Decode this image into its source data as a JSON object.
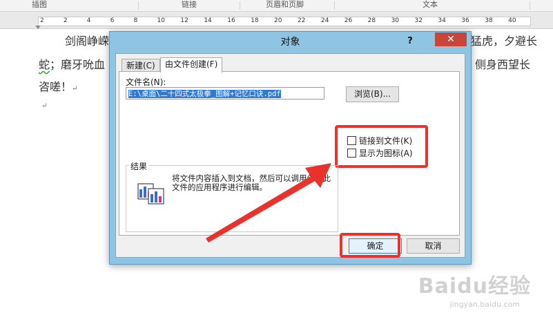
{
  "ribbon": {
    "groups": [
      "插图",
      "链接",
      "页眉和页脚",
      "文本"
    ]
  },
  "ruler": {
    "ticks": [
      "2",
      "2",
      "4",
      "6",
      "8",
      "10",
      "12",
      "14",
      "16",
      "18",
      "20",
      "22",
      "24",
      "26",
      "28",
      "30",
      "32",
      "34",
      "36",
      "38",
      "40"
    ]
  },
  "document": {
    "line1_start": "剑阁峥嵘",
    "line1_end": "猛虎，夕避长",
    "line2_start_wavy": "蛇",
    "line2_start_rest": "；磨牙吮血",
    "line2_end": "，侧身西望长",
    "line3": "咨嗟！",
    "para_mark": "↵"
  },
  "dialog": {
    "title": "对象",
    "help": "?",
    "close": "✕",
    "tabs": [
      {
        "label": "新建(C)",
        "active": false
      },
      {
        "label": "由文件创建(F)",
        "active": true
      }
    ],
    "file_name_label": "文件名(N):",
    "file_name_value": "E:\\桌面\\二十四式太极拳_图解+记忆口诀.pdf",
    "browse_label": "浏览(B)...",
    "checkboxes": [
      {
        "label": "链接到文件(K)",
        "checked": false
      },
      {
        "label": "显示为图标(A)",
        "checked": false
      }
    ],
    "result_title": "结果",
    "result_text": "将文件内容插入到文档，然后可以调用创建此文件的应用程序进行编辑。",
    "ok_label": "确定",
    "cancel_label": "取消"
  },
  "watermark": {
    "brand": "Baidu经验",
    "url": "jingyan.baidu.com"
  },
  "colors": {
    "annotation_red": "#e8322b",
    "dialog_frame": "#8fc4e3",
    "close_red": "#c7453a",
    "selection_blue": "#3079d6"
  }
}
